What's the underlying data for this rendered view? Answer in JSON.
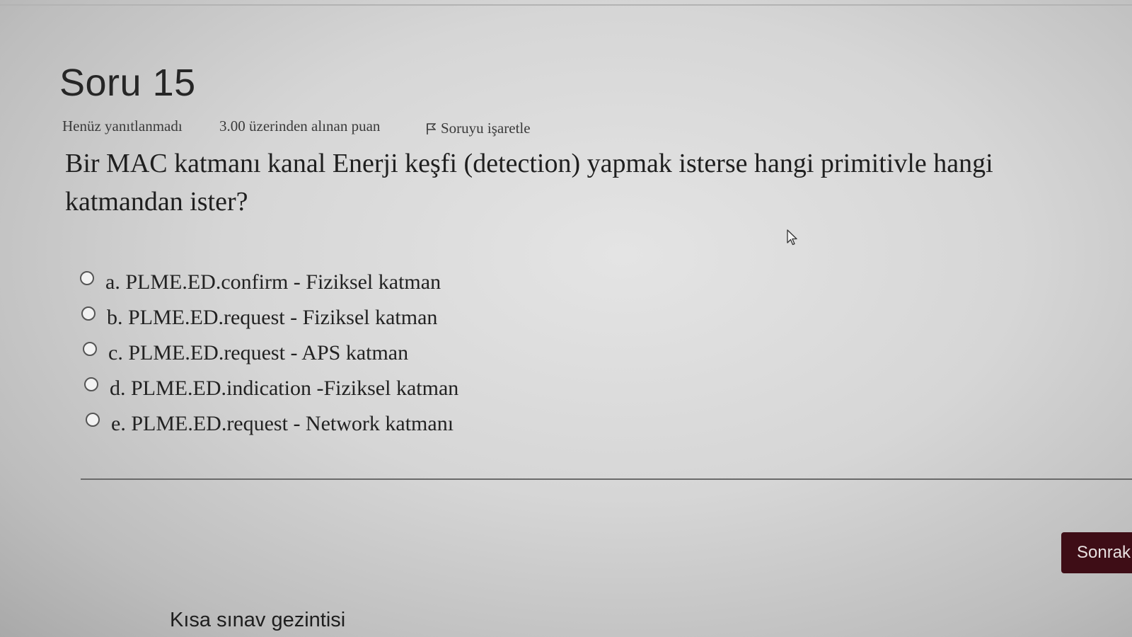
{
  "question": {
    "title": "Soru 15",
    "status": "Henüz yanıtlanmadı",
    "grade": "3.00 üzerinden alınan puan",
    "flag_label": "Soruyu işaretle",
    "text": "Bir MAC katmanı kanal Enerji keşfi (detection) yapmak isterse hangi primitivle hangi katmandan ister?"
  },
  "answers": [
    {
      "label": "a. PLME.ED.confirm - Fiziksel katman",
      "selected": false
    },
    {
      "label": "b. PLME.ED.request - Fiziksel katman",
      "selected": false
    },
    {
      "label": "c. PLME.ED.request - APS katman",
      "selected": false
    },
    {
      "label": "d. PLME.ED.indication -Fiziksel katman",
      "selected": false
    },
    {
      "label": "e. PLME.ED.request - Network katmanı",
      "selected": false
    }
  ],
  "navigation": {
    "next_label": "Sonrak",
    "quiz_nav_heading": "Kısa sınav gezintisi"
  },
  "colors": {
    "next_button_bg": "#3e0d16",
    "text": "#222222"
  }
}
